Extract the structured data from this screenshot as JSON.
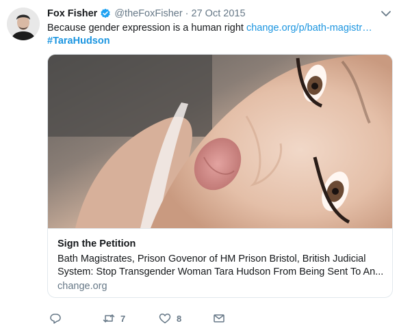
{
  "tweet": {
    "author_name": "Fox Fisher",
    "verified": true,
    "handle": "@theFoxFisher",
    "separator": "·",
    "date": "27 Oct 2015",
    "text": "Because gender expression is a human right",
    "link": "change.org/p/bath-magistr…",
    "hashtag": "#TaraHudson"
  },
  "card": {
    "title": "Sign the Petition",
    "description_line1": "Bath Magistrates, Prison Govenor of HM Prison Bristol, British Judicial",
    "description_line2": "System: Stop Transgender Woman Tara Hudson From Being Sent To An...",
    "domain": "change.org"
  },
  "actions": {
    "reply_icon": "reply-icon",
    "retweet_icon": "retweet-icon",
    "retweet_count": "7",
    "like_icon": "heart-icon",
    "like_count": "8",
    "dm_icon": "envelope-icon"
  },
  "colors": {
    "link": "#1b95e0",
    "secondary_text": "#657786",
    "verified_badge": "#1da1f2",
    "border": "#e1e8ed"
  }
}
